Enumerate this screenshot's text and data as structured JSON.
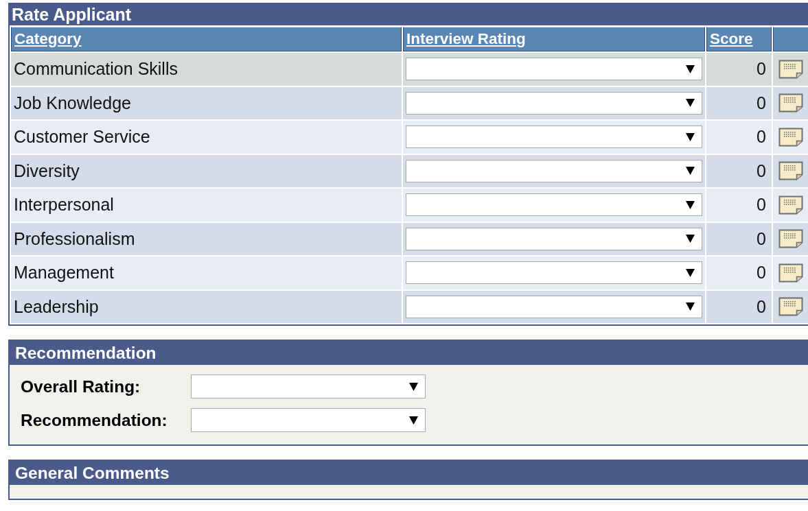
{
  "rate_applicant": {
    "title": "Rate Applicant",
    "columns": [
      "Category",
      "Interview Rating",
      "Score"
    ],
    "rows": [
      {
        "category": "Communication Skills",
        "score": "0",
        "selected": true
      },
      {
        "category": "Job Knowledge",
        "score": "0",
        "selected": false
      },
      {
        "category": "Customer Service",
        "score": "0",
        "selected": false
      },
      {
        "category": "Diversity",
        "score": "0",
        "selected": false
      },
      {
        "category": "Interpersonal",
        "score": "0",
        "selected": false
      },
      {
        "category": "Professionalism",
        "score": "0",
        "selected": false
      },
      {
        "category": "Management",
        "score": "0",
        "selected": false
      },
      {
        "category": "Leadership",
        "score": "0",
        "selected": false
      }
    ]
  },
  "recommendation": {
    "title": "Recommendation",
    "fields": [
      {
        "label": "Overall Rating:"
      },
      {
        "label": "Recommendation:"
      }
    ]
  },
  "general_comments": {
    "title": "General Comments"
  }
}
